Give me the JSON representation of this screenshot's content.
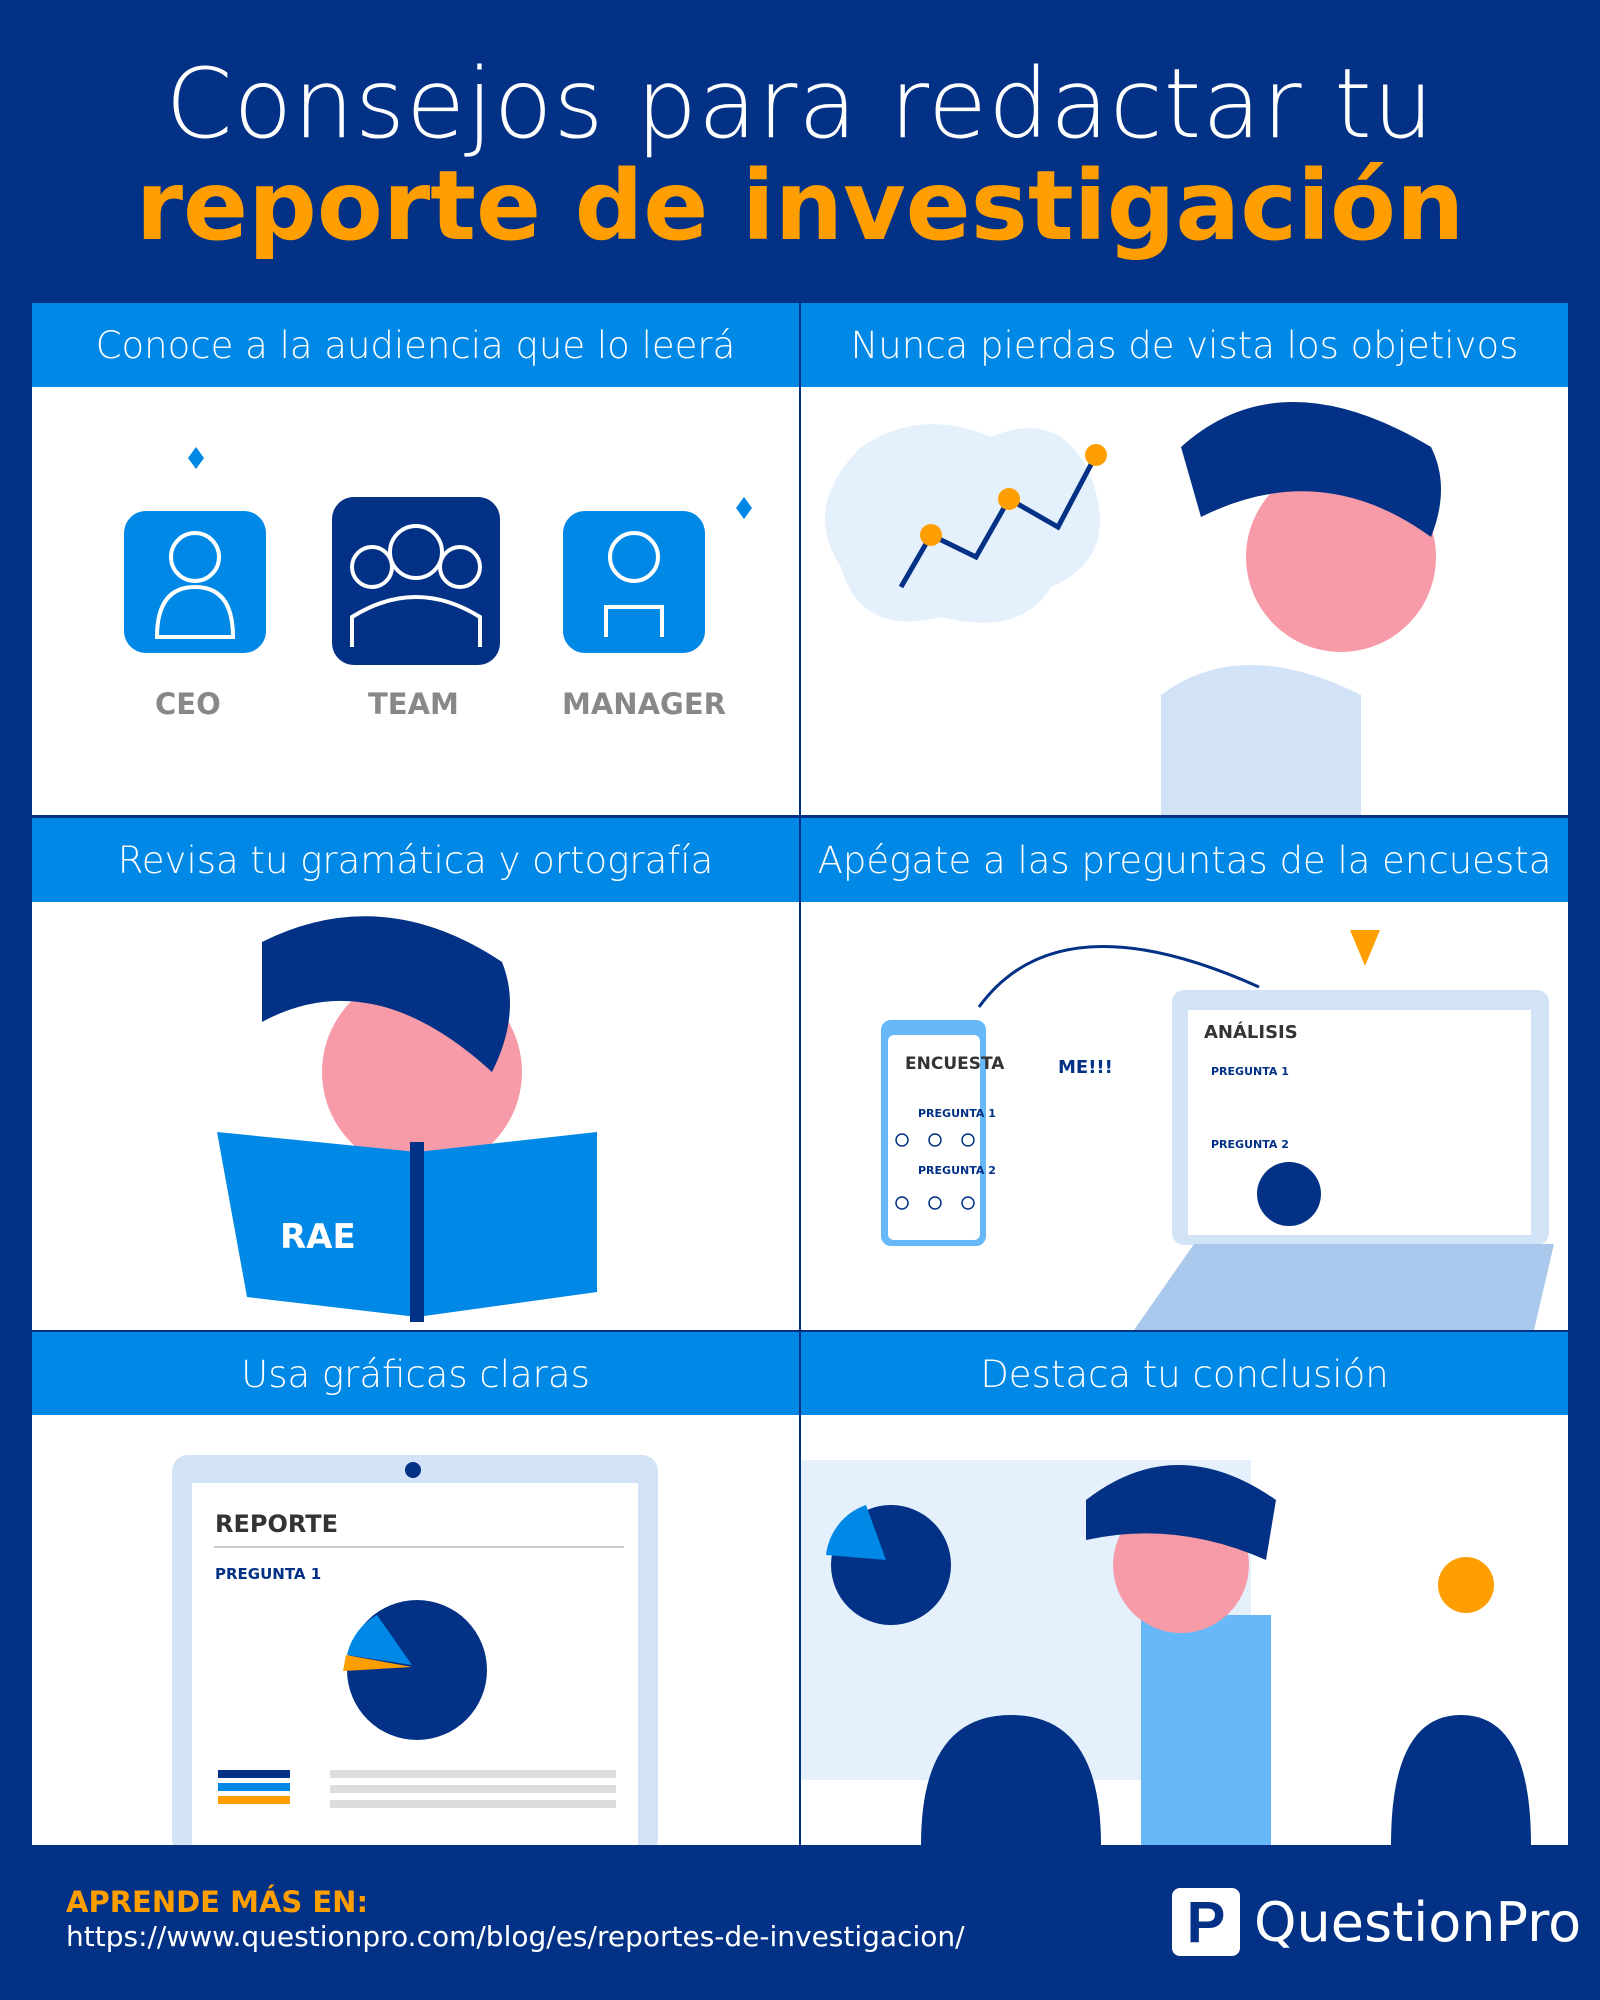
{
  "title": {
    "line1": "Consejos para redactar tu",
    "line2": "reporte de investigación"
  },
  "tips": [
    {
      "heading": "Conoce a la audiencia que lo leerá",
      "labels": [
        "CEO",
        "TEAM",
        "MANAGER"
      ]
    },
    {
      "heading": "Nunca pierdas de vista los objetivos"
    },
    {
      "heading": "Revisa tu gramática y ortografía",
      "book_label": "RAE"
    },
    {
      "heading": "Apégate a las preguntas de la encuesta",
      "phone_title": "ENCUESTA",
      "phone_q1": "PREGUNTA 1",
      "phone_q2": "PREGUNTA 2",
      "speech": "ME!!!",
      "laptop_title": "ANÁLISIS",
      "laptop_q1": "PREGUNTA 1",
      "laptop_q2": "PREGUNTA 2"
    },
    {
      "heading": "Usa gráficas claras",
      "report_title": "REPORTE",
      "report_q1": "PREGUNTA 1"
    },
    {
      "heading": "Destaca tu conclusión"
    }
  ],
  "footer": {
    "learn_more": "APRENDE MÁS EN:",
    "url": "https://www.questionpro.com/blog/es/reportes-de-investigacion/",
    "brand": "QuestionPro",
    "brand_mark": "P"
  },
  "colors": {
    "background": "#023185",
    "header": "#0088E6",
    "accent": "#FF9E00",
    "light_blue": "#66B8F8"
  }
}
